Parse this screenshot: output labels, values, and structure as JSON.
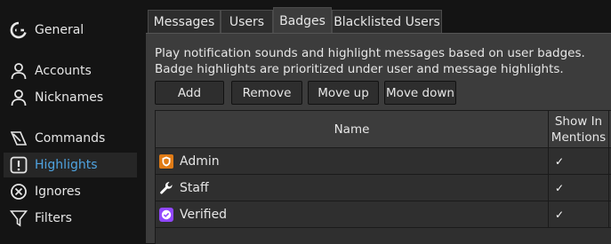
{
  "sidebar": {
    "items": [
      {
        "label": "General",
        "icon": "logo-icon"
      },
      {
        "label": "Accounts",
        "icon": "user-icon"
      },
      {
        "label": "Nicknames",
        "icon": "user-icon"
      },
      {
        "label": "Commands",
        "icon": "command-icon"
      },
      {
        "label": "Highlights",
        "icon": "exclamation-icon",
        "active": true
      },
      {
        "label": "Ignores",
        "icon": "ignore-icon"
      },
      {
        "label": "Filters",
        "icon": "filter-icon"
      }
    ]
  },
  "tabs": [
    "Messages",
    "Users",
    "Badges",
    "Blacklisted Users"
  ],
  "active_tab": "Badges",
  "description": {
    "line1": "Play notification sounds and highlight messages based on user badges.",
    "line2": "Badge highlights are prioritized under user and message highlights."
  },
  "buttons": {
    "add": "Add",
    "remove": "Remove",
    "move_up": "Move up",
    "move_down": "Move down"
  },
  "table": {
    "headers": {
      "name": "Name",
      "show_in_mentions_1": "Show In",
      "show_in_mentions_2": "Mentions"
    },
    "rows": [
      {
        "name": "Admin",
        "icon": "admin-shield-icon",
        "show_in_mentions": true
      },
      {
        "name": "Staff",
        "icon": "wrench-icon",
        "show_in_mentions": true
      },
      {
        "name": "Verified",
        "icon": "verified-check-icon",
        "show_in_mentions": true
      }
    ],
    "check_glyph": "✓"
  },
  "colors": {
    "active_sidebar_text": "#4fa3e0",
    "admin_badge": "#e07b16",
    "verified_badge": "#9147ff"
  }
}
